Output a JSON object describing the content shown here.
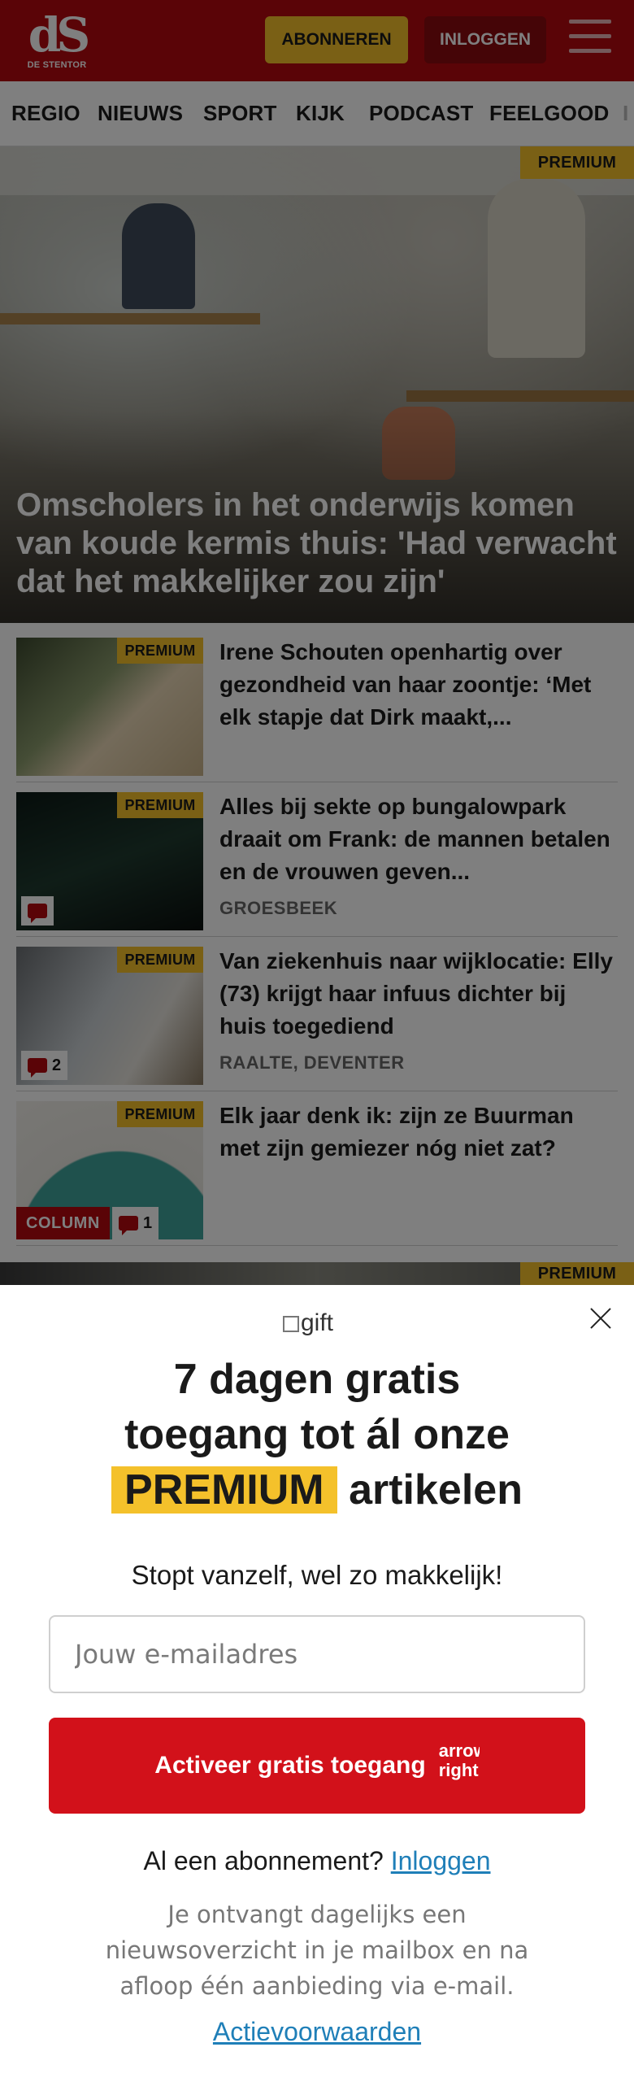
{
  "header": {
    "logo_mark": "dS",
    "logo_sub": "DE STENTOR",
    "subscribe_label": "ABONNEREN",
    "login_label": "INLOGGEN"
  },
  "nav": {
    "items": [
      "REGIO",
      "NIEUWS",
      "SPORT",
      "KIJK",
      "PODCAST",
      "FEELGOOD",
      "I"
    ]
  },
  "hero": {
    "badge": "PREMIUM",
    "title": "Omscholers in het onderwijs komen van koude kermis thuis: 'Had verwacht dat het makkelijker zou zijn'"
  },
  "articles": [
    {
      "badge": "PREMIUM",
      "title": "Irene Schouten openhartig over gezondheid van haar zoontje: ‘Met elk stapje dat Dirk maakt,...",
      "location": "",
      "comments": ""
    },
    {
      "badge": "PREMIUM",
      "title": "Alles bij sekte op bungalowpark draait om Frank: de mannen betalen en de vrouwen geven...",
      "location": "GROESBEEK",
      "comments": ""
    },
    {
      "badge": "PREMIUM",
      "title": "Van ziekenhuis naar wijklocatie: Elly (73) krijgt haar infuus dichter bij huis toegediend",
      "location": "RAALTE, DEVENTER",
      "comments": "2"
    },
    {
      "badge": "PREMIUM",
      "title": "Elk jaar denk ik: zijn ze Buurman met zijn gemiezer nóg niet zat?",
      "location": "",
      "comments": "1",
      "column_label": "COLUMN"
    }
  ],
  "next_badge": "PREMIUM",
  "popup": {
    "gift_alt": "gift",
    "headline_line1": "7 dagen gratis",
    "headline_line2": "toegang tot ál onze",
    "headline_highlight": "PREMIUM",
    "headline_tail": "artikelen",
    "subline": "Stopt vanzelf, wel zo makkelijk!",
    "email_placeholder": "Jouw e-mailadres",
    "activate_label": "Activeer gratis toegang",
    "arrow_alt": "arrow right",
    "already_text": "Al een abonnement?",
    "already_link": "Inloggen",
    "info": "Je ontvangt dagelijks een nieuwsoverzicht in je mailbox en na afloop één aanbieding via e-mail.",
    "terms": "Actievoorwaarden"
  },
  "colors": {
    "brand_red": "#b5090f",
    "premium_yellow": "#f4c12b",
    "cta_red": "#d2111a",
    "link_blue": "#1f7fb8"
  }
}
